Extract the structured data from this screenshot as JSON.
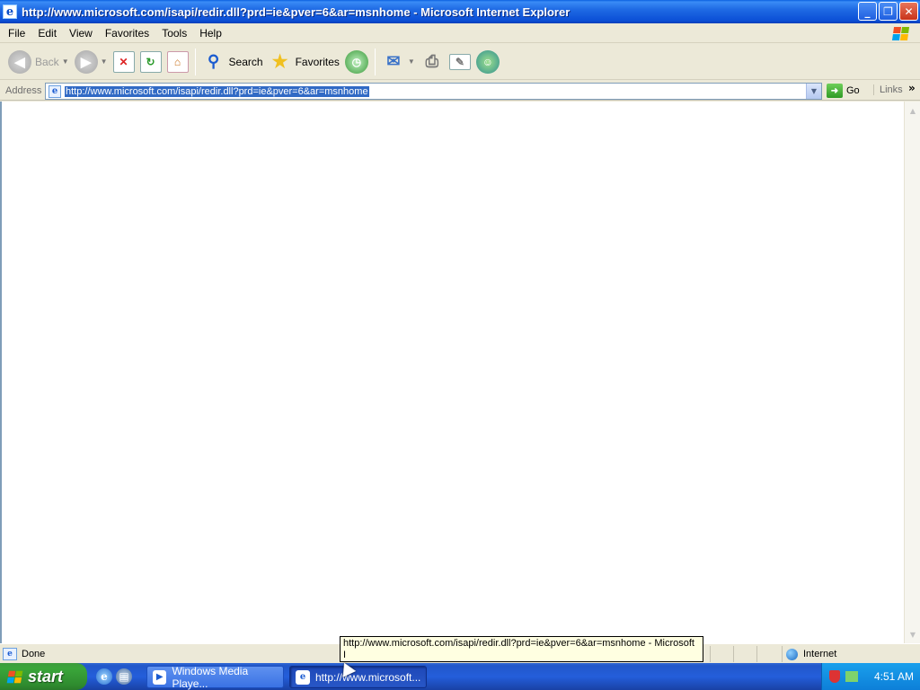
{
  "window": {
    "title": "http://www.microsoft.com/isapi/redir.dll?prd=ie&pver=6&ar=msnhome - Microsoft Internet Explorer",
    "minimize_glyph": "_",
    "restore_glyph": "❐",
    "close_glyph": "✕"
  },
  "menu": [
    "File",
    "Edit",
    "View",
    "Favorites",
    "Tools",
    "Help"
  ],
  "toolbar": {
    "back_label": "Back",
    "search_label": "Search",
    "favorites_label": "Favorites"
  },
  "address": {
    "label": "Address",
    "url": "http://www.microsoft.com/isapi/redir.dll?prd=ie&pver=6&ar=msnhome",
    "go_label": "Go",
    "links_label": "Links",
    "links_chevron": "»"
  },
  "status": {
    "text": "Done",
    "zone": "Internet"
  },
  "tooltip": {
    "line1": "http://www.microsoft.com/isapi/redir.dll?prd=ie&pver=6&ar=msnhome - Microsoft",
    "line2": "I"
  },
  "taskbar": {
    "start_label": "start",
    "tasks": [
      {
        "label": "Windows Media Playe..."
      },
      {
        "label": "http://www.microsoft..."
      }
    ],
    "clock": "4:51 AM"
  }
}
